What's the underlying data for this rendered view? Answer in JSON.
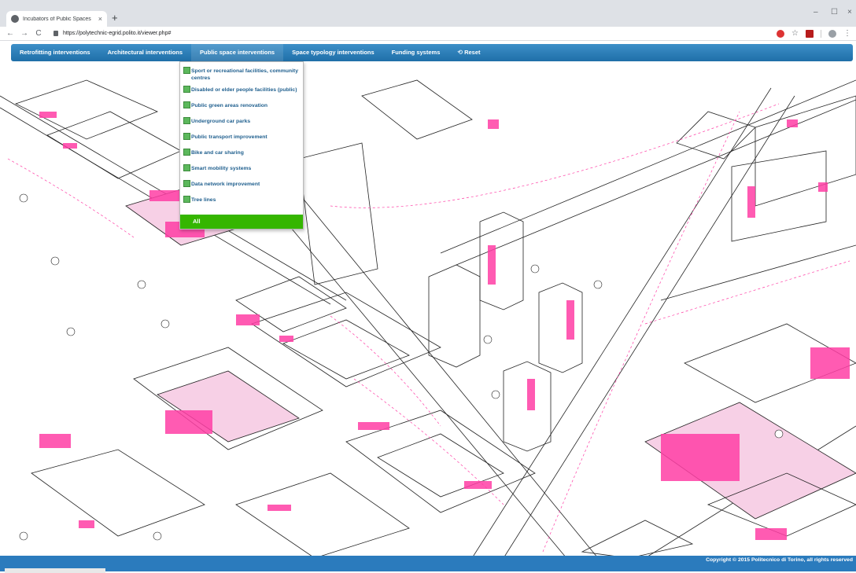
{
  "browser": {
    "tab_title": "Incubators of Public Spaces",
    "tab_close": "×",
    "new_tab": "+",
    "url": "https://polytechnic-egrid.polito.it/viewer.php#",
    "nav_back": "←",
    "nav_forward": "→",
    "nav_reload": "C",
    "win_min": "–",
    "win_max": "☐",
    "win_close": "×"
  },
  "navbar": {
    "items": [
      {
        "label": "Retrofitting interventions"
      },
      {
        "label": "Architectural interventions"
      },
      {
        "label": "Public space interventions"
      },
      {
        "label": "Space typology interventions"
      },
      {
        "label": "Funding systems"
      }
    ],
    "reset_label": "Reset"
  },
  "dropdown": {
    "items": [
      {
        "label": "Sport or recreational facilities, community centres"
      },
      {
        "label": "Disabled or elder people facilities (public)"
      },
      {
        "label": "Public green areas renovation"
      },
      {
        "label": "Underground car parks"
      },
      {
        "label": "Public transport improvement"
      },
      {
        "label": "Bike and car sharing"
      },
      {
        "label": "Smart mobility systems"
      },
      {
        "label": "Data network improvement"
      },
      {
        "label": "Tree lines"
      }
    ],
    "all_label": "All"
  },
  "footer": {
    "copyright": "Copyright © 2015 Politecnico di Torino, all rights reserved"
  },
  "colors": {
    "navbar": "#2b7bbd",
    "highlight": "#ff3ea5",
    "all_button": "#35b600",
    "dropdown_text": "#1f5f8e"
  }
}
